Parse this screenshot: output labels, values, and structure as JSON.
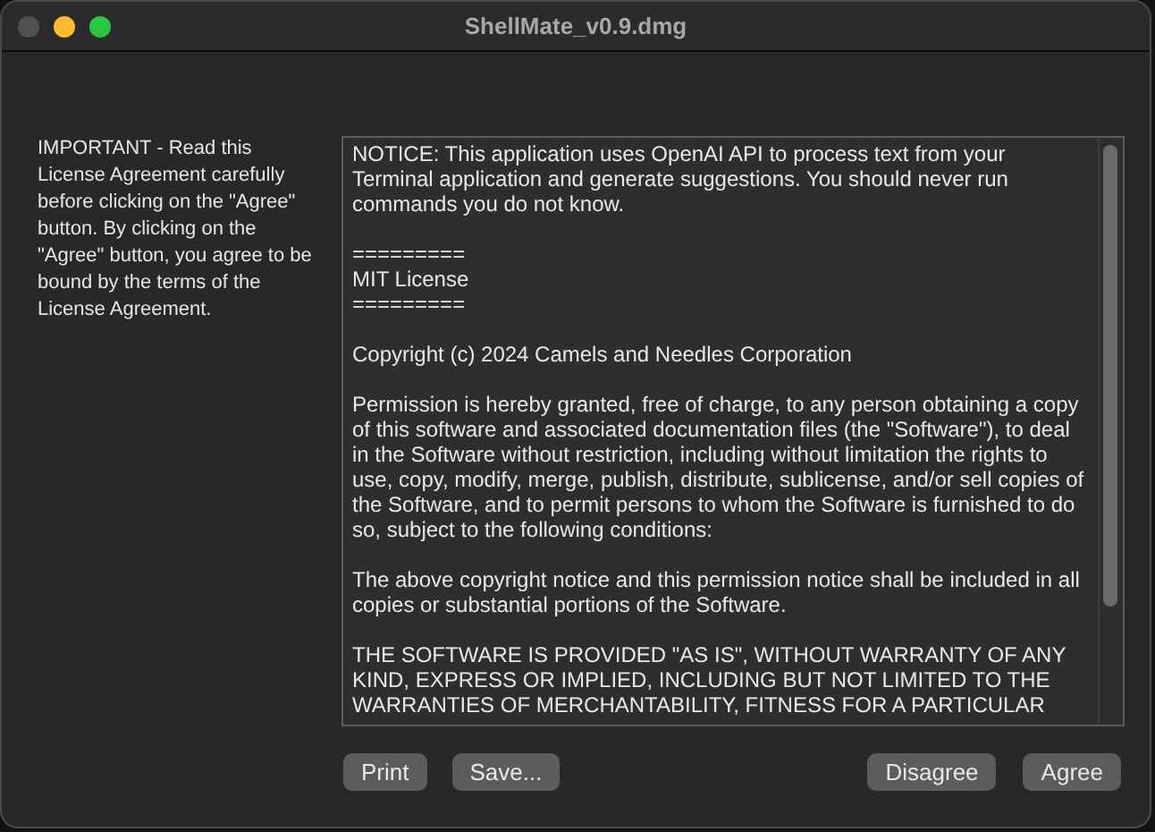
{
  "window": {
    "title": "ShellMate_v0.9.dmg"
  },
  "instructions": "IMPORTANT - Read this License Agreement carefully before clicking on the \"Agree\" button.   By clicking on the \"Agree\" button, you agree to be bound by the terms of the License Agreement.",
  "license": {
    "paragraphs": [
      "NOTICE: This application uses OpenAI API to process text from your Terminal application and generate suggestions.  You should never run commands you do not know.",
      "=========\nMIT License\n=========",
      "Copyright (c) 2024 Camels and Needles Corporation",
      "Permission is hereby granted, free of charge, to any person obtaining a copy of this software and associated documentation files (the \"Software\"), to deal in the Software without restriction, including without limitation the rights to use, copy, modify, merge, publish, distribute, sublicense, and/or sell copies of the Software, and to permit persons to whom the Software is furnished to do so, subject to the following conditions:",
      "The above copyright notice and this permission notice shall be included in all copies or substantial portions of the Software.",
      "THE SOFTWARE IS PROVIDED \"AS IS\", WITHOUT WARRANTY OF ANY KIND, EXPRESS OR IMPLIED, INCLUDING BUT NOT LIMITED TO THE WARRANTIES OF MERCHANTABILITY, FITNESS FOR A PARTICULAR"
    ]
  },
  "buttons_left": [
    {
      "label": "Print"
    },
    {
      "label": "Save..."
    }
  ],
  "buttons_right": [
    {
      "label": "Disagree"
    },
    {
      "label": "Agree"
    }
  ]
}
